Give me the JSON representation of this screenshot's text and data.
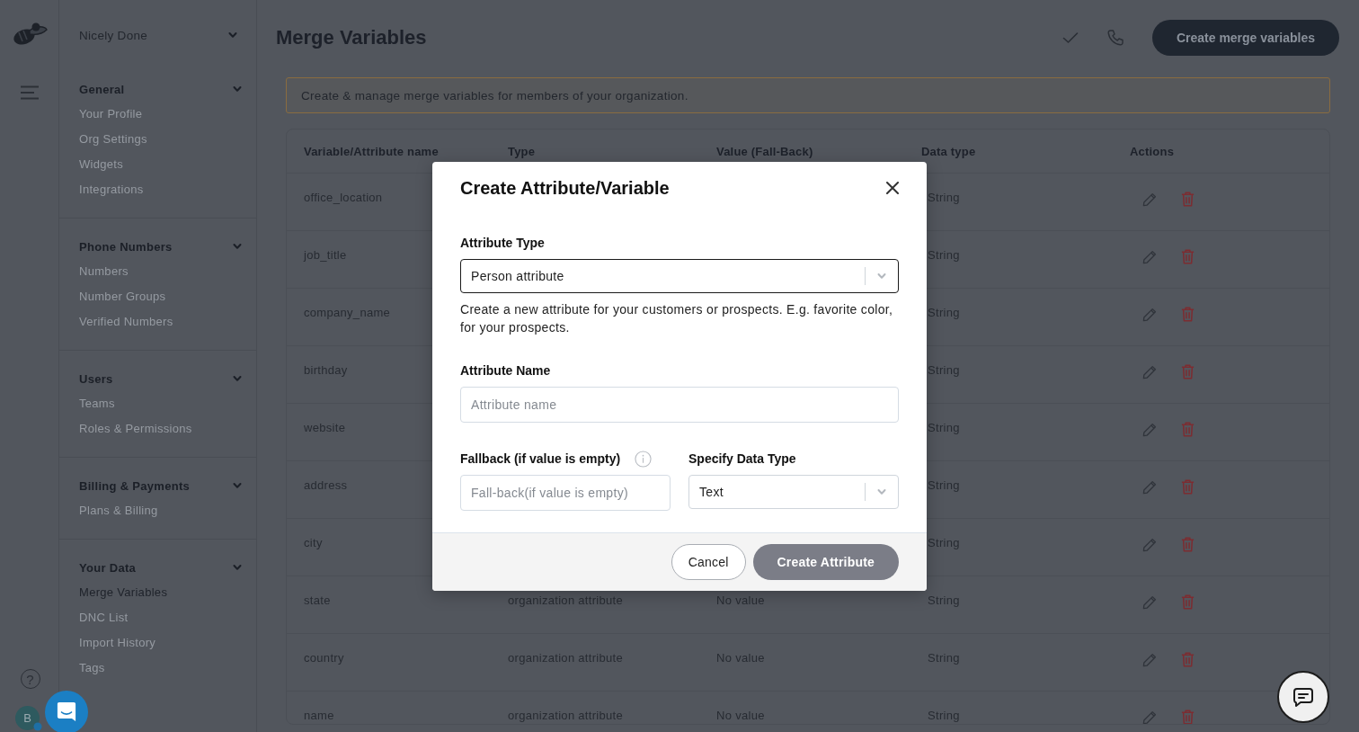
{
  "rail": {
    "help": "?",
    "avatar": {
      "initial": "B",
      "online": true
    }
  },
  "sidebar": {
    "org": "Nicely Done",
    "sections": [
      {
        "title": "General",
        "expanded": true,
        "items": [
          {
            "label": "Your Profile",
            "selected": false
          },
          {
            "label": "Org Settings",
            "selected": false
          },
          {
            "label": "Widgets",
            "selected": false
          },
          {
            "label": "Integrations",
            "selected": false
          }
        ]
      },
      {
        "title": "Phone Numbers",
        "expanded": true,
        "items": [
          {
            "label": "Numbers",
            "selected": false
          },
          {
            "label": "Number Groups",
            "selected": false
          },
          {
            "label": "Verified Numbers",
            "selected": false
          }
        ]
      },
      {
        "title": "Users",
        "expanded": true,
        "items": [
          {
            "label": "Teams",
            "selected": false
          },
          {
            "label": "Roles & Permissions",
            "selected": false
          }
        ]
      },
      {
        "title": "Billing & Payments",
        "expanded": true,
        "items": [
          {
            "label": "Plans & Billing",
            "selected": false
          }
        ]
      },
      {
        "title": "Your Data",
        "expanded": true,
        "items": [
          {
            "label": "Merge Variables",
            "selected": true
          },
          {
            "label": "DNC List",
            "selected": false
          },
          {
            "label": "Import History",
            "selected": false
          },
          {
            "label": "Tags",
            "selected": false
          }
        ]
      }
    ]
  },
  "header": {
    "title": "Merge Variables",
    "button": "Create merge variables"
  },
  "notice": "Create & manage merge variables for members of your organization.",
  "table": {
    "columns": [
      "Variable/Attribute name",
      "Type",
      "Value (Fall-Back)",
      "Data type",
      "Actions"
    ],
    "rows": [
      {
        "name": "office_location",
        "data_type": "String"
      },
      {
        "name": "job_title",
        "data_type": "String"
      },
      {
        "name": "company_name",
        "data_type": "String"
      },
      {
        "name": "birthday",
        "data_type": "String"
      },
      {
        "name": "website",
        "data_type": "String"
      },
      {
        "name": "address",
        "data_type": "String"
      },
      {
        "name": "city",
        "data_type": "String"
      },
      {
        "name": "state",
        "type": "organization attribute",
        "value": "No value",
        "data_type": "String"
      },
      {
        "name": "country",
        "type": "organization attribute",
        "value": "No value",
        "data_type": "String"
      },
      {
        "name": "name",
        "type": "organization attribute",
        "value": "No value",
        "data_type": "String"
      }
    ]
  },
  "modal": {
    "title": "Create Attribute/Variable",
    "attribute_type": {
      "label": "Attribute Type",
      "value": "Person attribute"
    },
    "help": "Create a new attribute for your customers or prospects. E.g. favorite color, for your prospects.",
    "attribute_name": {
      "label": "Attribute Name",
      "placeholder": "Attribute name"
    },
    "fallback": {
      "label": "Fallback (if value is empty)",
      "placeholder": "Fall-back(if value is empty)"
    },
    "data_type": {
      "label": "Specify Data Type",
      "value": "Text"
    },
    "buttons": [
      {
        "label": "Cancel",
        "kind": "secondary",
        "disabled": false
      },
      {
        "label": "Create Attribute",
        "kind": "primary",
        "disabled": true
      }
    ]
  }
}
